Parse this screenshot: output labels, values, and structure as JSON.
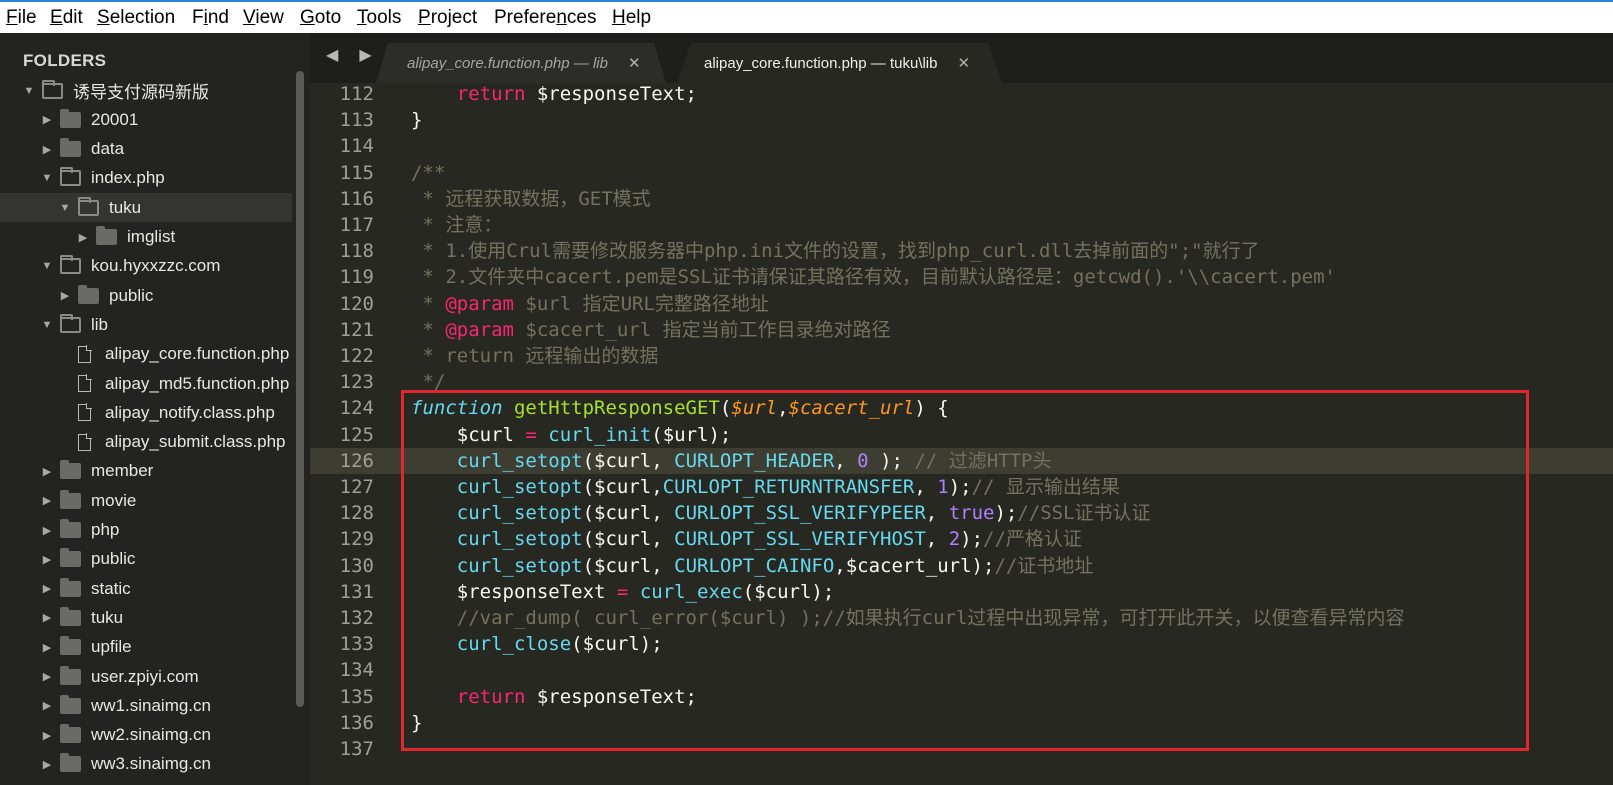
{
  "menu": [
    {
      "label": "File",
      "u": "F",
      "rest": "ile"
    },
    {
      "label": "Edit",
      "u": "E",
      "rest": "dit"
    },
    {
      "label": "Selection",
      "u": "S",
      "rest": "election"
    },
    {
      "label": "Find",
      "pre": "F",
      "u": "i",
      "rest": "nd"
    },
    {
      "label": "View",
      "u": "V",
      "rest": "iew"
    },
    {
      "label": "Goto",
      "u": "G",
      "rest": "oto"
    },
    {
      "label": "Tools",
      "u": "T",
      "rest": "ools"
    },
    {
      "label": "Project",
      "u": "P",
      "rest": "roject"
    },
    {
      "label": "Preferences",
      "pre": "Prefere",
      "u": "n",
      "rest": "ces"
    },
    {
      "label": "Help",
      "u": "H",
      "rest": "elp"
    }
  ],
  "sidebar": {
    "title": "FOLDERS",
    "items": [
      {
        "label": "诱导支付源码新版",
        "level": 0,
        "type": "folder",
        "expanded": true
      },
      {
        "label": "20001",
        "level": 1,
        "type": "folder",
        "expanded": false
      },
      {
        "label": "data",
        "level": 1,
        "type": "folder",
        "expanded": false
      },
      {
        "label": "index.php",
        "level": 1,
        "type": "folder",
        "expanded": true
      },
      {
        "label": "tuku",
        "level": 2,
        "type": "folder",
        "expanded": true,
        "selected": true
      },
      {
        "label": "imglist",
        "level": 3,
        "type": "folder",
        "expanded": false
      },
      {
        "label": "kou.hyxxzzc.com",
        "level": 1,
        "type": "folder",
        "expanded": true
      },
      {
        "label": "public",
        "level": 2,
        "type": "folder",
        "expanded": false
      },
      {
        "label": "lib",
        "level": 1,
        "type": "folder",
        "expanded": true
      },
      {
        "label": "alipay_core.function.php",
        "level": 2,
        "type": "file"
      },
      {
        "label": "alipay_md5.function.php",
        "level": 2,
        "type": "file"
      },
      {
        "label": "alipay_notify.class.php",
        "level": 2,
        "type": "file"
      },
      {
        "label": "alipay_submit.class.php",
        "level": 2,
        "type": "file"
      },
      {
        "label": "member",
        "level": 1,
        "type": "folder",
        "expanded": false
      },
      {
        "label": "movie",
        "level": 1,
        "type": "folder",
        "expanded": false
      },
      {
        "label": "php",
        "level": 1,
        "type": "folder",
        "expanded": false
      },
      {
        "label": "public",
        "level": 1,
        "type": "folder",
        "expanded": false
      },
      {
        "label": "static",
        "level": 1,
        "type": "folder",
        "expanded": false
      },
      {
        "label": "tuku",
        "level": 1,
        "type": "folder",
        "expanded": false
      },
      {
        "label": "upfile",
        "level": 1,
        "type": "folder",
        "expanded": false
      },
      {
        "label": "user.zpiyi.com",
        "level": 1,
        "type": "folder",
        "expanded": false
      },
      {
        "label": "ww1.sinaimg.cn",
        "level": 1,
        "type": "folder",
        "expanded": false
      },
      {
        "label": "ww2.sinaimg.cn",
        "level": 1,
        "type": "folder",
        "expanded": false
      },
      {
        "label": "ww3.sinaimg.cn",
        "level": 1,
        "type": "folder",
        "expanded": false
      }
    ]
  },
  "tabs": [
    {
      "label": "alipay_core.function.php — lib",
      "active": false,
      "close": "✕"
    },
    {
      "label": "alipay_core.function.php — tuku\\lib",
      "active": true,
      "close": "✕"
    }
  ],
  "nav_arrows": "◀ ▶",
  "editor": {
    "highlighted_line": 126,
    "lines": [
      {
        "n": "112",
        "seg": [
          {
            "t": "    "
          },
          {
            "t": "return",
            "c": "kw"
          },
          {
            "t": " $responseText;"
          }
        ]
      },
      {
        "n": "113",
        "seg": [
          {
            "t": "}"
          }
        ]
      },
      {
        "n": "114",
        "seg": []
      },
      {
        "n": "115",
        "seg": [
          {
            "t": "/**",
            "c": "cm"
          }
        ]
      },
      {
        "n": "116",
        "seg": [
          {
            "t": " * 远程获取数据，GET模式",
            "c": "cm"
          }
        ]
      },
      {
        "n": "117",
        "seg": [
          {
            "t": " * 注意：",
            "c": "cm"
          }
        ]
      },
      {
        "n": "118",
        "seg": [
          {
            "t": " * 1.使用Crul需要修改服务器中php.ini文件的设置，找到php_curl.dll去掉前面的\";\"就行了",
            "c": "cm"
          }
        ]
      },
      {
        "n": "119",
        "seg": [
          {
            "t": " * 2.文件夹中cacert.pem是SSL证书请保证其路径有效，目前默认路径是：getcwd().'\\\\cacert.pem'",
            "c": "cm"
          }
        ]
      },
      {
        "n": "120",
        "seg": [
          {
            "t": " * ",
            "c": "cm"
          },
          {
            "t": "@param",
            "c": "kw"
          },
          {
            "t": " $url 指定URL完整路径地址",
            "c": "cm"
          }
        ]
      },
      {
        "n": "121",
        "seg": [
          {
            "t": " * ",
            "c": "cm"
          },
          {
            "t": "@param",
            "c": "kw"
          },
          {
            "t": " $cacert_url 指定当前工作目录绝对路径",
            "c": "cm"
          }
        ]
      },
      {
        "n": "122",
        "seg": [
          {
            "t": " * return 远程输出的数据",
            "c": "cm"
          }
        ]
      },
      {
        "n": "123",
        "seg": [
          {
            "t": " */",
            "c": "cm"
          }
        ]
      },
      {
        "n": "124",
        "seg": [
          {
            "t": "function",
            "c": "sto"
          },
          {
            "t": " "
          },
          {
            "t": "getHttpResponseGET",
            "c": "fnd"
          },
          {
            "t": "("
          },
          {
            "t": "$url",
            "c": "pa"
          },
          {
            "t": ","
          },
          {
            "t": "$cacert_url",
            "c": "pa"
          },
          {
            "t": ") {"
          }
        ]
      },
      {
        "n": "125",
        "seg": [
          {
            "t": "    $curl "
          },
          {
            "t": "=",
            "c": "kw"
          },
          {
            "t": " "
          },
          {
            "t": "curl_init",
            "c": "fn"
          },
          {
            "t": "($url);"
          }
        ]
      },
      {
        "n": "126",
        "seg": [
          {
            "t": "    "
          },
          {
            "t": "curl_setopt",
            "c": "fn"
          },
          {
            "t": "($curl, "
          },
          {
            "t": "CURLOPT_HEADER",
            "c": "fn"
          },
          {
            "t": ", "
          },
          {
            "t": "0",
            "c": "nu"
          },
          {
            "t": " ); "
          },
          {
            "t": "// 过滤HTTP头",
            "c": "cm"
          }
        ]
      },
      {
        "n": "127",
        "seg": [
          {
            "t": "    "
          },
          {
            "t": "curl_setopt",
            "c": "fn"
          },
          {
            "t": "($curl,"
          },
          {
            "t": "CURLOPT_RETURNTRANSFER",
            "c": "fn"
          },
          {
            "t": ", "
          },
          {
            "t": "1",
            "c": "nu"
          },
          {
            "t": ");"
          },
          {
            "t": "// 显示输出结果",
            "c": "cm"
          }
        ]
      },
      {
        "n": "128",
        "seg": [
          {
            "t": "    "
          },
          {
            "t": "curl_setopt",
            "c": "fn"
          },
          {
            "t": "($curl, "
          },
          {
            "t": "CURLOPT_SSL_VERIFYPEER",
            "c": "fn"
          },
          {
            "t": ", "
          },
          {
            "t": "true",
            "c": "nu"
          },
          {
            "t": ");"
          },
          {
            "t": "//SSL证书认证",
            "c": "cm"
          }
        ]
      },
      {
        "n": "129",
        "seg": [
          {
            "t": "    "
          },
          {
            "t": "curl_setopt",
            "c": "fn"
          },
          {
            "t": "($curl, "
          },
          {
            "t": "CURLOPT_SSL_VERIFYHOST",
            "c": "fn"
          },
          {
            "t": ", "
          },
          {
            "t": "2",
            "c": "nu"
          },
          {
            "t": ");"
          },
          {
            "t": "//严格认证",
            "c": "cm"
          }
        ]
      },
      {
        "n": "130",
        "seg": [
          {
            "t": "    "
          },
          {
            "t": "curl_setopt",
            "c": "fn"
          },
          {
            "t": "($curl, "
          },
          {
            "t": "CURLOPT_CAINFO",
            "c": "fn"
          },
          {
            "t": ",$cacert_url);"
          },
          {
            "t": "//证书地址",
            "c": "cm"
          }
        ]
      },
      {
        "n": "131",
        "seg": [
          {
            "t": "    $responseText "
          },
          {
            "t": "=",
            "c": "kw"
          },
          {
            "t": " "
          },
          {
            "t": "curl_exec",
            "c": "fn"
          },
          {
            "t": "($curl);"
          }
        ]
      },
      {
        "n": "132",
        "seg": [
          {
            "t": "    //var_dump( curl_error($curl) );//如果执行curl过程中出现异常，可打开此开关，以便查看异常内容",
            "c": "cm"
          }
        ]
      },
      {
        "n": "133",
        "seg": [
          {
            "t": "    "
          },
          {
            "t": "curl_close",
            "c": "fn"
          },
          {
            "t": "($curl);"
          }
        ]
      },
      {
        "n": "134",
        "seg": []
      },
      {
        "n": "135",
        "seg": [
          {
            "t": "    "
          },
          {
            "t": "return",
            "c": "kw"
          },
          {
            "t": " $responseText;"
          }
        ]
      },
      {
        "n": "136",
        "seg": [
          {
            "t": "}"
          }
        ]
      },
      {
        "n": "137",
        "seg": []
      }
    ]
  },
  "colors": {
    "annotation_box": "#e4252b",
    "editor_bg": "#272822",
    "sidebar_bg": "#232421"
  }
}
